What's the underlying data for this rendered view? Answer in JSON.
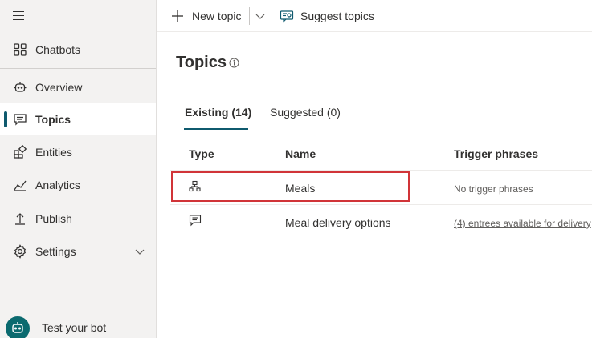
{
  "sidebar": {
    "items": [
      {
        "label": "Chatbots"
      },
      {
        "label": "Overview"
      },
      {
        "label": "Topics"
      },
      {
        "label": "Entities"
      },
      {
        "label": "Analytics"
      },
      {
        "label": "Publish"
      },
      {
        "label": "Settings"
      }
    ],
    "test_bot_label": "Test your bot"
  },
  "toolbar": {
    "new_topic_label": "New topic",
    "suggest_topics_label": "Suggest topics"
  },
  "page": {
    "title": "Topics"
  },
  "tabs": [
    {
      "label": "Existing (14)",
      "selected": true
    },
    {
      "label": "Suggested (0)",
      "selected": false
    }
  ],
  "table": {
    "headers": [
      "Type",
      "Name",
      "Trigger phrases"
    ],
    "rows": [
      {
        "type_icon": "flow-icon",
        "name": "Meals",
        "trigger": "No trigger phrases"
      },
      {
        "type_icon": "chat-icon",
        "name": "Meal delivery options",
        "trigger": "(4) entrees available for delivery"
      }
    ]
  },
  "colors": {
    "accent": "#0f5a6e",
    "highlight": "#d13438",
    "sidebar_bg": "#f3f2f1"
  }
}
